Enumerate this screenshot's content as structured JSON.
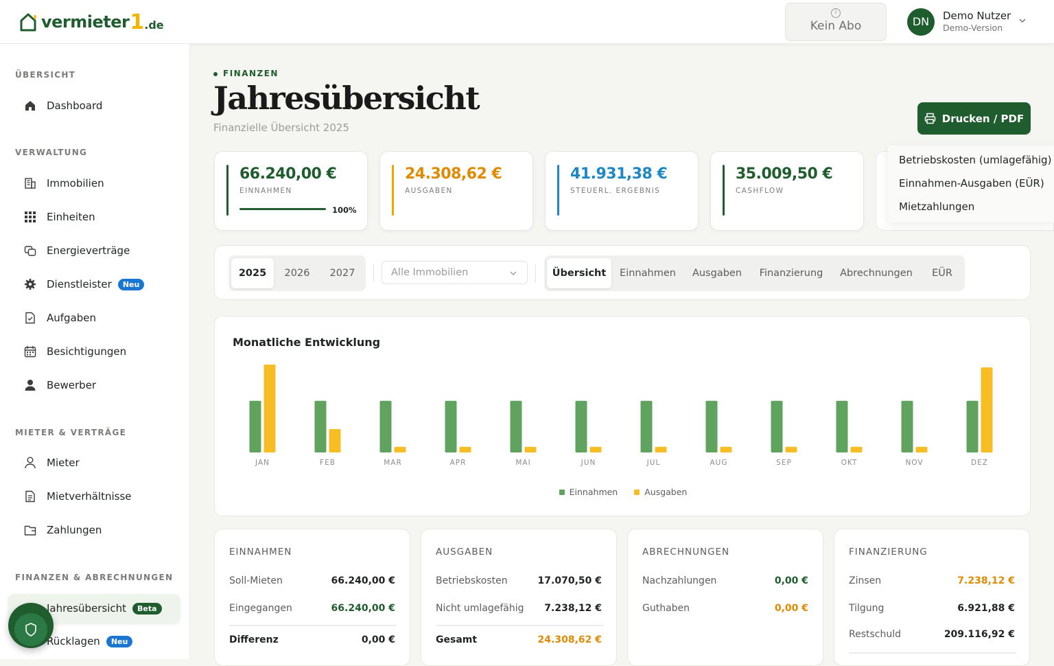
{
  "brand": {
    "name": "vermieter",
    "one": "1",
    "tld": ".de"
  },
  "header": {
    "abo_label": "Kein Abo",
    "abo_icon": "info-icon",
    "user_initials": "DN",
    "user_name": "Demo Nutzer",
    "user_sub": "Demo-Version"
  },
  "sidebar": {
    "groups": [
      "ÜBERSICHT",
      "VERWALTUNG",
      "MIETER & VERTRÄGE",
      "FINANZEN & ABRECHNUNGEN"
    ],
    "items": [
      {
        "label": "Dashboard",
        "icon": "home-icon"
      },
      {
        "label": "Immobilien",
        "icon": "building-icon"
      },
      {
        "label": "Einheiten",
        "icon": "grid-icon"
      },
      {
        "label": "Energieverträge",
        "icon": "contract-icon"
      },
      {
        "label": "Dienstleister",
        "icon": "gear-icon",
        "badge": "Neu"
      },
      {
        "label": "Aufgaben",
        "icon": "task-icon"
      },
      {
        "label": "Besichtigungen",
        "icon": "calendar-icon"
      },
      {
        "label": "Bewerber",
        "icon": "user-icon"
      },
      {
        "label": "Mieter",
        "icon": "person-icon"
      },
      {
        "label": "Mietverhältnisse",
        "icon": "document-icon"
      },
      {
        "label": "Zahlungen",
        "icon": "wallet-icon"
      },
      {
        "label": "Jahresübersicht",
        "icon": "chart-icon",
        "badge": "Beta",
        "active": true
      },
      {
        "label": "Rücklagen",
        "icon": "savings-icon",
        "badge": "Neu"
      }
    ]
  },
  "page": {
    "eyebrow": "FINANZEN",
    "title": "Jahresübersicht",
    "subtitle": "Finanzielle Übersicht 2025",
    "print_label": "Drucken / PDF"
  },
  "kpis": [
    {
      "value": "66.240,00 €",
      "label": "EINNAHMEN",
      "color": "#1f5c2e",
      "progress_label": "100%",
      "progress": 1.0
    },
    {
      "value": "24.308,62 €",
      "label": "AUSGABEN",
      "color": "#e08a00"
    },
    {
      "value": "41.931,38 €",
      "label": "STEUERL. ERGEBNIS",
      "color": "#1e88c7"
    },
    {
      "value": "35.009,50 €",
      "label": "CASHFLOW",
      "color": "#1f5c2e"
    }
  ],
  "dropdown": {
    "items": [
      "Betriebskosten (umlagefähig)",
      "Einnahmen-Ausgaben (EÜR)",
      "Mietzahlungen"
    ]
  },
  "filters": {
    "years": [
      "2025",
      "2026",
      "2027"
    ],
    "active_year": "2025",
    "property_select": "Alle Immobilien",
    "tabs": [
      "Übersicht",
      "Einnahmen",
      "Ausgaben",
      "Finanzierung",
      "Abrechnungen",
      "EÜR"
    ],
    "active_tab": "Übersicht"
  },
  "chart_title": "Monatliche Entwicklung",
  "chart_data": {
    "type": "bar",
    "categories": [
      "JAN",
      "FEB",
      "MAR",
      "APR",
      "MAI",
      "JUN",
      "JUL",
      "AUG",
      "SEP",
      "OKT",
      "NOV",
      "DEZ"
    ],
    "series": [
      {
        "name": "Einnahmen",
        "color": "#5fa35f",
        "values": [
          5520,
          5520,
          5520,
          5520,
          5520,
          5520,
          5520,
          5520,
          5520,
          5520,
          5520,
          5520
        ]
      },
      {
        "name": "Ausgaben",
        "color": "#f7bd24",
        "values": [
          9400,
          2500,
          600,
          600,
          600,
          600,
          600,
          600,
          600,
          600,
          600,
          9100
        ]
      }
    ],
    "legend": "bottom",
    "grid": false
  },
  "cards": {
    "einnahmen": {
      "title": "EINNAHMEN",
      "rows": [
        {
          "label": "Soll-Mieten",
          "value": "66.240,00 €"
        },
        {
          "label": "Eingegangen",
          "value": "66.240,00 €"
        }
      ],
      "sum_label": "Differenz",
      "sum_value": "0,00 €"
    },
    "ausgaben": {
      "title": "AUSGABEN",
      "rows": [
        {
          "label": "Betriebskosten",
          "value": "17.070,50 €"
        },
        {
          "label": "Nicht umlagefähig",
          "value": "7.238,12 €"
        }
      ],
      "sum_label": "Gesamt",
      "sum_value": "24.308,62 €"
    },
    "abrechnungen": {
      "title": "ABRECHNUNGEN",
      "rows": [
        {
          "label": "Nachzahlungen",
          "value": "0,00 €"
        },
        {
          "label": "Guthaben",
          "value": "0,00 €"
        }
      ]
    },
    "finanzierung": {
      "title": "FINANZIERUNG",
      "rows": [
        {
          "label": "Zinsen",
          "value": "7.238,12 €"
        },
        {
          "label": "Tilgung",
          "value": "6.921,88 €"
        },
        {
          "label": "Restschuld",
          "value": "209.116,92 €"
        }
      ]
    }
  }
}
